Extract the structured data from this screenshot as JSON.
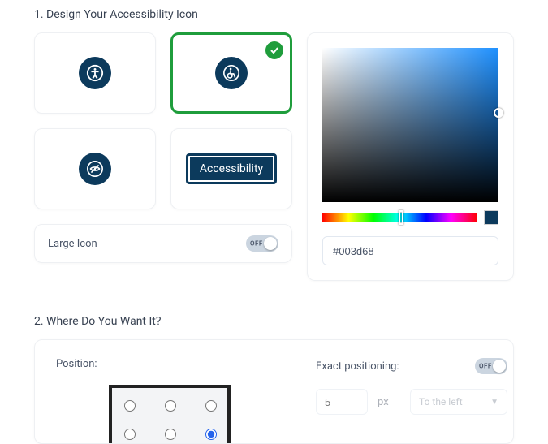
{
  "section1": {
    "title": "1. Design Your Accessibility Icon",
    "icons": [
      {
        "name": "person-icon",
        "selected": false
      },
      {
        "name": "wheelchair-icon",
        "selected": true
      },
      {
        "name": "eye-slash-icon",
        "selected": false
      },
      {
        "name": "text-button",
        "label": "Accessibility",
        "selected": false
      }
    ],
    "largeIcon": {
      "label": "Large Icon",
      "state": "OFF"
    },
    "color": {
      "hex": "#003d68",
      "swatch": "#0c3a5c"
    }
  },
  "section2": {
    "title": "2. Where Do You Want It?",
    "positionLabel": "Position:",
    "selectedCell": 5,
    "exact": {
      "label": "Exact positioning:",
      "state": "OFF",
      "rows": [
        {
          "value": "5",
          "unit": "px",
          "dir": "To the left"
        }
      ]
    }
  }
}
